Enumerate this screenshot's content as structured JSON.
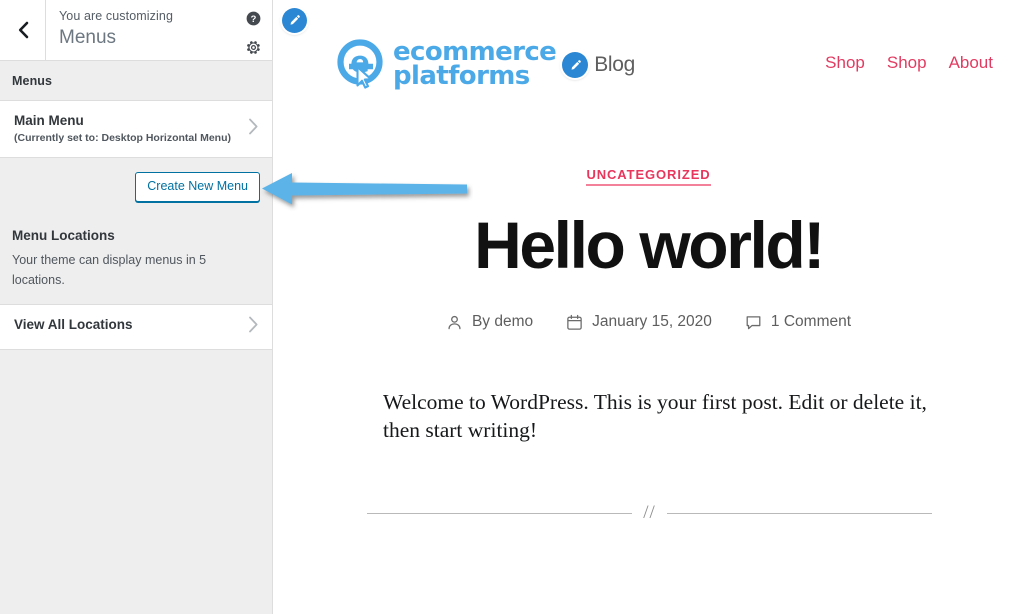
{
  "customizer": {
    "back_icon": "chevron-left-icon",
    "subtitle": "You are customizing",
    "title": "Menus",
    "help_icon": "help-circle-icon",
    "gear_icon": "gear-icon",
    "section_label": "Menus",
    "menu_item": {
      "title": "Main Menu",
      "subtitle": "(Currently set to: Desktop Horizontal Menu)",
      "chevron": "chevron-right-icon"
    },
    "create_button": "Create New Menu",
    "locations": {
      "title": "Menu Locations",
      "description": "Your theme can display menus in 5 locations.",
      "view_all": "View All Locations",
      "chevron": "chevron-right-icon"
    },
    "accent_color": "#0071a1",
    "panel_bg": "#eeeeee"
  },
  "annotation": {
    "arrow_icon": "left-arrow-annotation",
    "color": "#5BB3E8"
  },
  "site": {
    "edit_pencil_icon": "pencil-edit-icon",
    "logo": {
      "mark_icon": "ecommerce-platforms-e-logo",
      "line1": "ecommerce",
      "line2": "platforms",
      "color": "#4BA9E8",
      "cursor_icon": "mouse-cursor-icon"
    },
    "blog_label": "Blog",
    "nav": [
      {
        "label": "Shop"
      },
      {
        "label": "Shop"
      },
      {
        "label": "About"
      }
    ],
    "nav_color": "#e23b61"
  },
  "post": {
    "category": "UNCATEGORIZED",
    "category_color": "#e8365d",
    "title": "Hello world!",
    "meta": {
      "author_icon": "person-icon",
      "author": "By demo",
      "date_icon": "calendar-icon",
      "date": "January 15, 2020",
      "comments_icon": "comment-bubble-icon",
      "comments": "1 Comment"
    },
    "body": "Welcome to WordPress. This is your first post. Edit or delete it, then start writing!",
    "divider_glyph": "//"
  }
}
